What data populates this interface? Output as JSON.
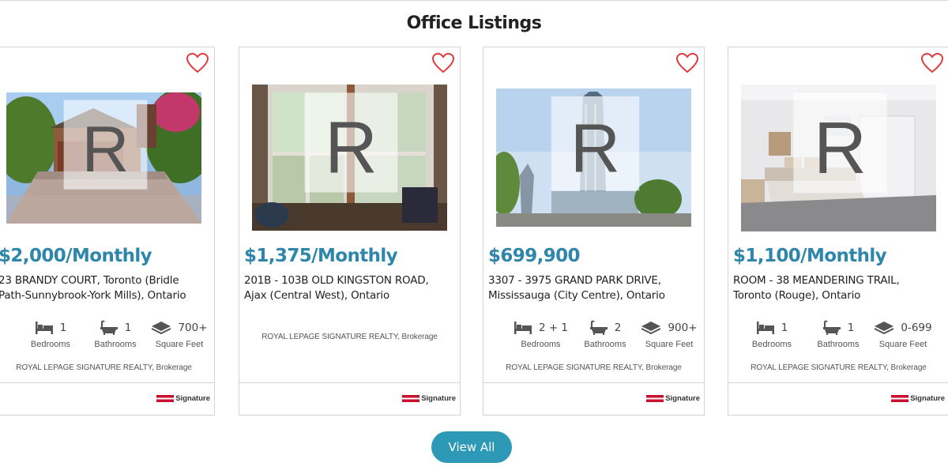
{
  "page": {
    "title": "Office Listings"
  },
  "listings": [
    {
      "price": "$2,000/Monthly",
      "address": "23 BRANDY COURT, Toronto (Bridle Path-Sunnybrook-York Mills), Ontario",
      "beds": "1",
      "baths": "1",
      "sqft": "700+",
      "brokerage": "ROYAL LEPAGE SIGNATURE REALTY, Brokerage"
    },
    {
      "price": "$1,375/Monthly",
      "address": "201B - 103B OLD KINGSTON ROAD, Ajax (Central West), Ontario",
      "brokerage": "ROYAL LEPAGE SIGNATURE REALTY, Brokerage"
    },
    {
      "price": "$699,900",
      "address": "3307 - 3975 GRAND PARK DRIVE, Mississauga (City Centre), Ontario",
      "beds": "2 + 1",
      "baths": "2",
      "sqft": "900+",
      "brokerage": "ROYAL LEPAGE SIGNATURE REALTY, Brokerage"
    },
    {
      "price": "$1,100/Monthly",
      "address": "ROOM - 38 MEANDERING TRAIL, Toronto (Rouge), Ontario",
      "beds": "1",
      "baths": "1",
      "sqft": "0-699",
      "brokerage": "ROYAL LEPAGE SIGNATURE REALTY, Brokerage"
    }
  ],
  "labels": {
    "bedrooms": "Bedrooms",
    "bathrooms": "Bathrooms",
    "square_feet": "Square Feet"
  },
  "footer_logo": {
    "text": "Signature"
  },
  "view_all": {
    "label": "View All"
  },
  "colors": {
    "accent": "#2e86ab",
    "button": "#2e98b7",
    "heart": "#e03a3e",
    "logo_red": "#c8102e"
  },
  "icons": [
    "heart-icon",
    "bed-icon",
    "bathtub-icon",
    "square-feet-icon",
    "realtor-logo-icon"
  ]
}
